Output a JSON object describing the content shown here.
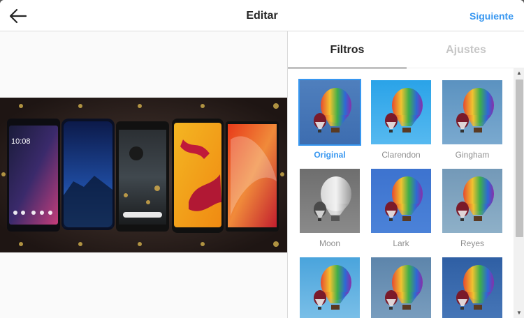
{
  "header": {
    "title": "Editar",
    "next_label": "Siguiente",
    "back_icon": "arrow-left-icon"
  },
  "tabs": [
    {
      "label": "Filtros",
      "active": true
    },
    {
      "label": "Ajustes",
      "active": false
    }
  ],
  "filters": [
    {
      "name": "Original",
      "selected": true,
      "bg1": "#4f7fbd",
      "bg2": "#3d6db0"
    },
    {
      "name": "Clarendon",
      "selected": false,
      "bg1": "#2aa3e8",
      "bg2": "#56b9f0"
    },
    {
      "name": "Gingham",
      "selected": false,
      "bg1": "#5b92c0",
      "bg2": "#7aa9cf"
    },
    {
      "name": "Moon",
      "selected": false,
      "bg1": "#6e6e6e",
      "bg2": "#8a8a8a"
    },
    {
      "name": "Lark",
      "selected": false,
      "bg1": "#3d73cf",
      "bg2": "#4b82d8"
    },
    {
      "name": "Reyes",
      "selected": false,
      "bg1": "#7399b8",
      "bg2": "#8eb0c8"
    },
    {
      "name": "",
      "selected": false,
      "bg1": "#4aa4dc",
      "bg2": "#7cc0e8"
    },
    {
      "name": "",
      "selected": false,
      "bg1": "#5d85ab",
      "bg2": "#7a9ebf"
    },
    {
      "name": "",
      "selected": false,
      "bg1": "#2f5fa4",
      "bg2": "#4777b8"
    }
  ],
  "colors": {
    "accent": "#3897f0",
    "text": "#262626",
    "muted": "#8e8e8e"
  },
  "preview": {
    "screen_text": "10:08"
  }
}
